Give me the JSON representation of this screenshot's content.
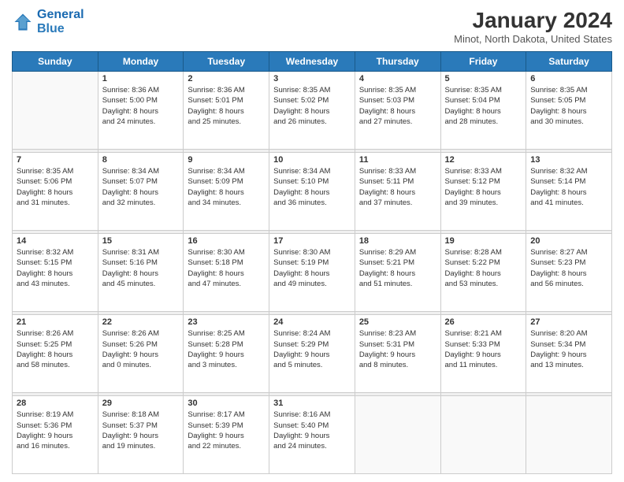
{
  "logo": {
    "line1": "General",
    "line2": "Blue"
  },
  "title": "January 2024",
  "subtitle": "Minot, North Dakota, United States",
  "days_header": [
    "Sunday",
    "Monday",
    "Tuesday",
    "Wednesday",
    "Thursday",
    "Friday",
    "Saturday"
  ],
  "weeks": [
    [
      {
        "day": "",
        "info": ""
      },
      {
        "day": "1",
        "info": "Sunrise: 8:36 AM\nSunset: 5:00 PM\nDaylight: 8 hours\nand 24 minutes."
      },
      {
        "day": "2",
        "info": "Sunrise: 8:36 AM\nSunset: 5:01 PM\nDaylight: 8 hours\nand 25 minutes."
      },
      {
        "day": "3",
        "info": "Sunrise: 8:35 AM\nSunset: 5:02 PM\nDaylight: 8 hours\nand 26 minutes."
      },
      {
        "day": "4",
        "info": "Sunrise: 8:35 AM\nSunset: 5:03 PM\nDaylight: 8 hours\nand 27 minutes."
      },
      {
        "day": "5",
        "info": "Sunrise: 8:35 AM\nSunset: 5:04 PM\nDaylight: 8 hours\nand 28 minutes."
      },
      {
        "day": "6",
        "info": "Sunrise: 8:35 AM\nSunset: 5:05 PM\nDaylight: 8 hours\nand 30 minutes."
      }
    ],
    [
      {
        "day": "7",
        "info": "Sunrise: 8:35 AM\nSunset: 5:06 PM\nDaylight: 8 hours\nand 31 minutes."
      },
      {
        "day": "8",
        "info": "Sunrise: 8:34 AM\nSunset: 5:07 PM\nDaylight: 8 hours\nand 32 minutes."
      },
      {
        "day": "9",
        "info": "Sunrise: 8:34 AM\nSunset: 5:09 PM\nDaylight: 8 hours\nand 34 minutes."
      },
      {
        "day": "10",
        "info": "Sunrise: 8:34 AM\nSunset: 5:10 PM\nDaylight: 8 hours\nand 36 minutes."
      },
      {
        "day": "11",
        "info": "Sunrise: 8:33 AM\nSunset: 5:11 PM\nDaylight: 8 hours\nand 37 minutes."
      },
      {
        "day": "12",
        "info": "Sunrise: 8:33 AM\nSunset: 5:12 PM\nDaylight: 8 hours\nand 39 minutes."
      },
      {
        "day": "13",
        "info": "Sunrise: 8:32 AM\nSunset: 5:14 PM\nDaylight: 8 hours\nand 41 minutes."
      }
    ],
    [
      {
        "day": "14",
        "info": "Sunrise: 8:32 AM\nSunset: 5:15 PM\nDaylight: 8 hours\nand 43 minutes."
      },
      {
        "day": "15",
        "info": "Sunrise: 8:31 AM\nSunset: 5:16 PM\nDaylight: 8 hours\nand 45 minutes."
      },
      {
        "day": "16",
        "info": "Sunrise: 8:30 AM\nSunset: 5:18 PM\nDaylight: 8 hours\nand 47 minutes."
      },
      {
        "day": "17",
        "info": "Sunrise: 8:30 AM\nSunset: 5:19 PM\nDaylight: 8 hours\nand 49 minutes."
      },
      {
        "day": "18",
        "info": "Sunrise: 8:29 AM\nSunset: 5:21 PM\nDaylight: 8 hours\nand 51 minutes."
      },
      {
        "day": "19",
        "info": "Sunrise: 8:28 AM\nSunset: 5:22 PM\nDaylight: 8 hours\nand 53 minutes."
      },
      {
        "day": "20",
        "info": "Sunrise: 8:27 AM\nSunset: 5:23 PM\nDaylight: 8 hours\nand 56 minutes."
      }
    ],
    [
      {
        "day": "21",
        "info": "Sunrise: 8:26 AM\nSunset: 5:25 PM\nDaylight: 8 hours\nand 58 minutes."
      },
      {
        "day": "22",
        "info": "Sunrise: 8:26 AM\nSunset: 5:26 PM\nDaylight: 9 hours\nand 0 minutes."
      },
      {
        "day": "23",
        "info": "Sunrise: 8:25 AM\nSunset: 5:28 PM\nDaylight: 9 hours\nand 3 minutes."
      },
      {
        "day": "24",
        "info": "Sunrise: 8:24 AM\nSunset: 5:29 PM\nDaylight: 9 hours\nand 5 minutes."
      },
      {
        "day": "25",
        "info": "Sunrise: 8:23 AM\nSunset: 5:31 PM\nDaylight: 9 hours\nand 8 minutes."
      },
      {
        "day": "26",
        "info": "Sunrise: 8:21 AM\nSunset: 5:33 PM\nDaylight: 9 hours\nand 11 minutes."
      },
      {
        "day": "27",
        "info": "Sunrise: 8:20 AM\nSunset: 5:34 PM\nDaylight: 9 hours\nand 13 minutes."
      }
    ],
    [
      {
        "day": "28",
        "info": "Sunrise: 8:19 AM\nSunset: 5:36 PM\nDaylight: 9 hours\nand 16 minutes."
      },
      {
        "day": "29",
        "info": "Sunrise: 8:18 AM\nSunset: 5:37 PM\nDaylight: 9 hours\nand 19 minutes."
      },
      {
        "day": "30",
        "info": "Sunrise: 8:17 AM\nSunset: 5:39 PM\nDaylight: 9 hours\nand 22 minutes."
      },
      {
        "day": "31",
        "info": "Sunrise: 8:16 AM\nSunset: 5:40 PM\nDaylight: 9 hours\nand 24 minutes."
      },
      {
        "day": "",
        "info": ""
      },
      {
        "day": "",
        "info": ""
      },
      {
        "day": "",
        "info": ""
      }
    ]
  ]
}
